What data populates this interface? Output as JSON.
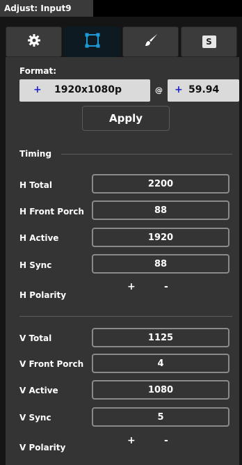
{
  "window": {
    "title": "Adjust: Input9"
  },
  "tabs": [
    {
      "name": "settings",
      "icon": "gear-icon"
    },
    {
      "name": "crop",
      "icon": "crop-square-icon"
    },
    {
      "name": "paint",
      "icon": "paintbrush-icon"
    },
    {
      "name": "s",
      "icon": "s-letter-icon",
      "label": "S"
    }
  ],
  "format": {
    "label": "Format:",
    "resolution": "1920x1080p",
    "at": "@",
    "rate": "59.94",
    "plus": "+",
    "apply": "Apply"
  },
  "timing": {
    "section_label": "Timing",
    "h_total": {
      "label": "H Total",
      "value": "2200"
    },
    "h_front_porch": {
      "label": "H Front Porch",
      "value": "88"
    },
    "h_active": {
      "label": "H Active",
      "value": "1920"
    },
    "h_sync": {
      "label": "H Sync",
      "value": "88"
    },
    "h_polarity": {
      "label": "H Polarity",
      "plus": "+",
      "minus": "-"
    },
    "v_total": {
      "label": "V Total",
      "value": "1125"
    },
    "v_front_porch": {
      "label": "V Front Porch",
      "value": "4"
    },
    "v_active": {
      "label": "V Active",
      "value": "1080"
    },
    "v_sync": {
      "label": "V Sync",
      "value": "5"
    },
    "v_polarity": {
      "label": "V Polarity",
      "plus": "+",
      "minus": "-"
    }
  },
  "colors": {
    "active_tab_icon": "#1e9ad6",
    "plus_sign": "#2222cc"
  }
}
